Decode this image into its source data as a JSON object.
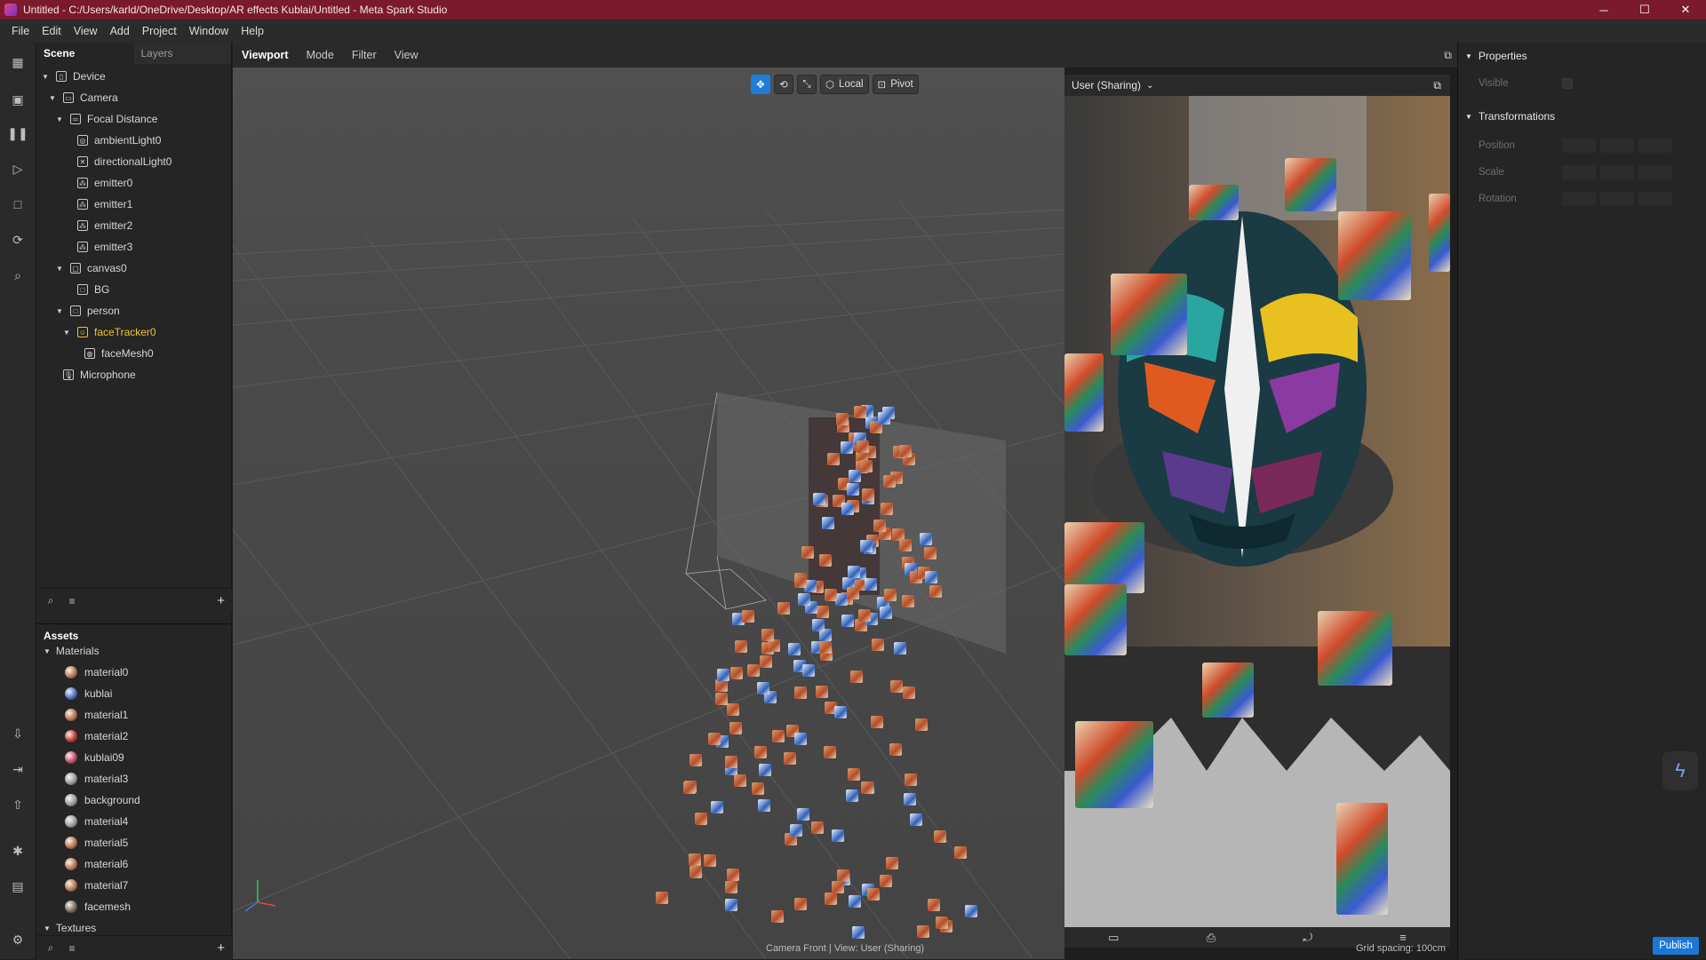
{
  "titlebar": {
    "title": "Untitled - C:/Users/karld/OneDrive/Desktop/AR effects Kublai/Untitled - Meta Spark Studio",
    "minimize": "─",
    "maximize": "☐",
    "close": "✕"
  },
  "menubar": [
    "File",
    "Edit",
    "View",
    "Add",
    "Project",
    "Window",
    "Help"
  ],
  "scene_panel": {
    "tabs": [
      "Scene",
      "Layers"
    ],
    "tree": [
      {
        "label": "Device",
        "depth": 0,
        "expanded": true,
        "icon": "device-icon"
      },
      {
        "label": "Camera",
        "depth": 1,
        "expanded": true,
        "icon": "camera-icon"
      },
      {
        "label": "Focal Distance",
        "depth": 2,
        "expanded": true,
        "icon": "focal-distance-icon"
      },
      {
        "label": "ambientLight0",
        "depth": 3,
        "icon": "ambient-light-icon"
      },
      {
        "label": "directionalLight0",
        "depth": 3,
        "icon": "directional-light-icon"
      },
      {
        "label": "emitter0",
        "depth": 3,
        "icon": "emitter-icon"
      },
      {
        "label": "emitter1",
        "depth": 3,
        "icon": "emitter-icon"
      },
      {
        "label": "emitter2",
        "depth": 3,
        "icon": "emitter-icon"
      },
      {
        "label": "emitter3",
        "depth": 3,
        "icon": "emitter-icon"
      },
      {
        "label": "canvas0",
        "depth": 2,
        "expanded": true,
        "icon": "canvas-icon"
      },
      {
        "label": "BG",
        "depth": 3,
        "icon": "rectangle-icon"
      },
      {
        "label": "person",
        "depth": 2,
        "expanded": true,
        "icon": "rectangle-icon"
      },
      {
        "label": "faceTracker0",
        "depth": 3,
        "expanded": true,
        "icon": "face-tracker-icon",
        "selected": true
      },
      {
        "label": "faceMesh0",
        "depth": 4,
        "icon": "face-mesh-icon"
      },
      {
        "label": "Microphone",
        "depth": 1,
        "icon": "microphone-icon"
      }
    ]
  },
  "assets_panel": {
    "title": "Assets",
    "materials_group": "Materials",
    "materials": [
      "material0",
      "kublai",
      "material1",
      "material2",
      "kublai09",
      "material3",
      "background",
      "material4",
      "material5",
      "material6",
      "material7",
      "facemesh"
    ],
    "material_colors": [
      "#b9754a",
      "#4a6fc0",
      "#b9754a",
      "#c23a2a",
      "#c04a6a",
      "#9a9a9a",
      "#9a9a9a",
      "#9a9a9a",
      "#b9754a",
      "#b9754a",
      "#b9754a",
      "#7a6a5a"
    ],
    "textures_group": "Textures"
  },
  "viewport": {
    "tabs": [
      "Viewport",
      "Mode",
      "Filter",
      "View"
    ],
    "toolbar": {
      "local": "Local",
      "pivot": "Pivot"
    },
    "status": "Camera Front | View: User (Sharing)",
    "grid_spacing": "Grid spacing: 100cm"
  },
  "simulator": {
    "device_label": "User (Sharing)"
  },
  "properties": {
    "section": "Properties",
    "visible_label": "Visible",
    "transformations": "Transformations",
    "position_label": "Position",
    "scale_label": "Scale",
    "rotation_label": "Rotation"
  },
  "publish_label": "Publish",
  "colors": {
    "titlebar": "#7a1a2a",
    "accent": "#1f7dd9",
    "selected": "#f2c230"
  }
}
